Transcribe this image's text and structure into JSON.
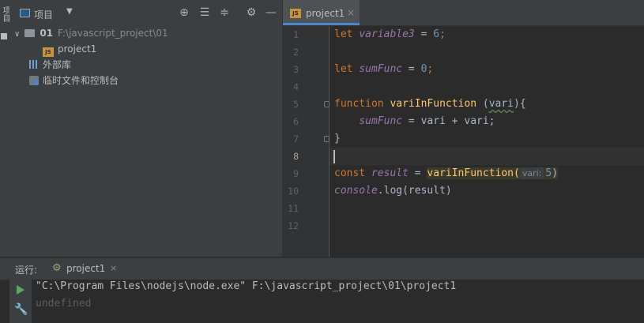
{
  "toolstrip": {
    "vertical_label": "项目"
  },
  "project_panel": {
    "title": "项目",
    "icons": [
      "target-icon",
      "expand-all-icon",
      "collapse-all-icon",
      "gear-icon",
      "minimize-icon"
    ],
    "tree": [
      {
        "name": "01",
        "path": "F:\\javascript_project\\01",
        "type": "folder",
        "expanded": true
      },
      {
        "name": "project1",
        "type": "js-file"
      },
      {
        "name": "外部库",
        "type": "library"
      },
      {
        "name": "临时文件和控制台",
        "type": "scratches"
      }
    ]
  },
  "editor": {
    "tab": {
      "label": "project1",
      "icon": "js-icon",
      "close": "×"
    },
    "line_numbers": [
      "1",
      "2",
      "3",
      "4",
      "5",
      "6",
      "7",
      "8",
      "9",
      "10",
      "11",
      "12"
    ],
    "current_line": 8,
    "lines": {
      "l1": {
        "kw": "let",
        "var": "variable3",
        "op": " = ",
        "num": "6",
        "end": ";"
      },
      "l3": {
        "kw": "let",
        "var": "sumFunc",
        "op": " = ",
        "num": "0",
        "end": ";"
      },
      "l5": {
        "kw": "function",
        "fn": "variInFunction",
        "open": " (",
        "param": "vari",
        "close": "){"
      },
      "l6": {
        "var": "sumFunc",
        "rest": " = vari + vari;"
      },
      "l7": {
        "text": "}"
      },
      "l9": {
        "kw": "const",
        "var": "result",
        "op": " = ",
        "fn": "variInFunction(",
        "hint": "vari:",
        "num": "5",
        "close": ")"
      },
      "l10": {
        "obj": "console",
        "rest": ".log(result)"
      }
    }
  },
  "run_panel": {
    "label": "运行:",
    "tab_label": "project1",
    "tab_close": "×",
    "console_lines": [
      "\"C:\\Program Files\\nodejs\\node.exe\" F:\\javascript_project\\01\\project1",
      "undefined"
    ],
    "colors": {
      "command": "#bbbbbb",
      "output": "#5e5e5e",
      "play": "#59a869"
    }
  },
  "theme": {
    "background": "#2b2b2b",
    "panel": "#3c3f41",
    "keyword": "#cc7832",
    "function": "#ffc66d",
    "variable": "#9876aa",
    "number": "#6897bb"
  }
}
